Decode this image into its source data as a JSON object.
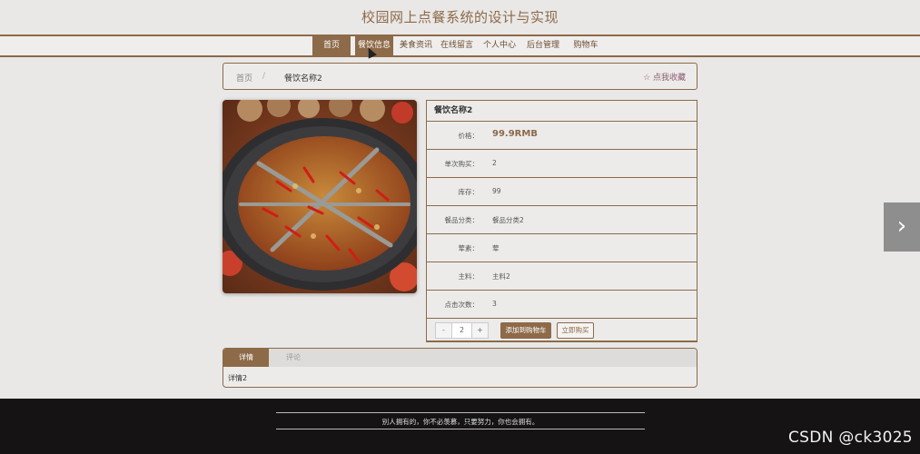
{
  "site": {
    "title": "校园网上点餐系统的设计与实现"
  },
  "nav": {
    "items": [
      {
        "label": "首页",
        "active": true
      },
      {
        "label": "餐饮信息",
        "active": false,
        "hover": true
      },
      {
        "label": "美食资讯",
        "active": false
      },
      {
        "label": "在线留言",
        "active": false
      },
      {
        "label": "个人中心",
        "active": false
      },
      {
        "label": "后台管理",
        "active": false
      },
      {
        "label": "购物车",
        "active": false
      }
    ]
  },
  "breadcrumb": {
    "home": "首页",
    "separator": "/",
    "current": "餐饮名称2",
    "favorite": "☆ 点我收藏"
  },
  "product": {
    "name": "餐饮名称2",
    "fields": [
      {
        "label": "价格：",
        "value": "99.9RMB",
        "emphasis": true
      },
      {
        "label": "单次购买：",
        "value": "2"
      },
      {
        "label": "库存：",
        "value": "99"
      },
      {
        "label": "餐品分类：",
        "value": "餐品分类2"
      },
      {
        "label": "荤素：",
        "value": "荤"
      },
      {
        "label": "主料：",
        "value": "主料2"
      },
      {
        "label": "点击次数：",
        "value": "3"
      }
    ],
    "quantity": {
      "minus": "-",
      "value": "2",
      "plus": "+"
    },
    "add_to_cart": "添加到购物车",
    "buy_now": "立即购买"
  },
  "tabs": {
    "items": [
      "详情",
      "评论"
    ],
    "content": "详情2"
  },
  "footer": {
    "text": "别人拥有的，你不必羡慕，只要努力，你也会拥有。"
  },
  "watermark": "CSDN @ck3025",
  "colors": {
    "accent": "#8d6a48",
    "background": "#e9e8e7",
    "footer": "#151313"
  },
  "icons": {
    "next": "chevron-right-icon",
    "favorite": "star-outline-icon"
  }
}
